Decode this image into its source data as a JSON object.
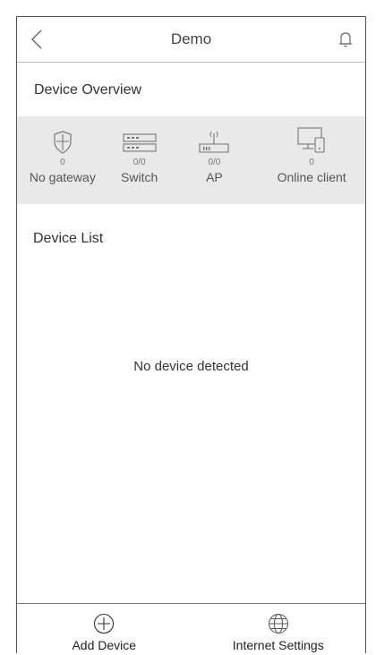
{
  "header": {
    "title": "Demo",
    "back_icon": "chevron-left-icon",
    "right_icon": "bell-icon"
  },
  "overview": {
    "title": "Device Overview",
    "items": [
      {
        "count": "0",
        "label": "No gateway",
        "icon": "shield-icon"
      },
      {
        "count": "0/0",
        "label": "Switch",
        "icon": "switch-icon"
      },
      {
        "count": "0/0",
        "label": "AP",
        "icon": "access-point-icon"
      },
      {
        "count": "0",
        "label": "Online client",
        "icon": "computer-phone-icon"
      }
    ]
  },
  "device_list": {
    "title": "Device List",
    "empty_message": "No device detected"
  },
  "bottom_bar": {
    "items": [
      {
        "label": "Add Device",
        "icon": "plus-circle-icon"
      },
      {
        "label": "Internet Settings",
        "icon": "globe-icon"
      }
    ]
  },
  "colors": {
    "strip_background": "#e9e9e9",
    "frame_border": "#555555"
  }
}
